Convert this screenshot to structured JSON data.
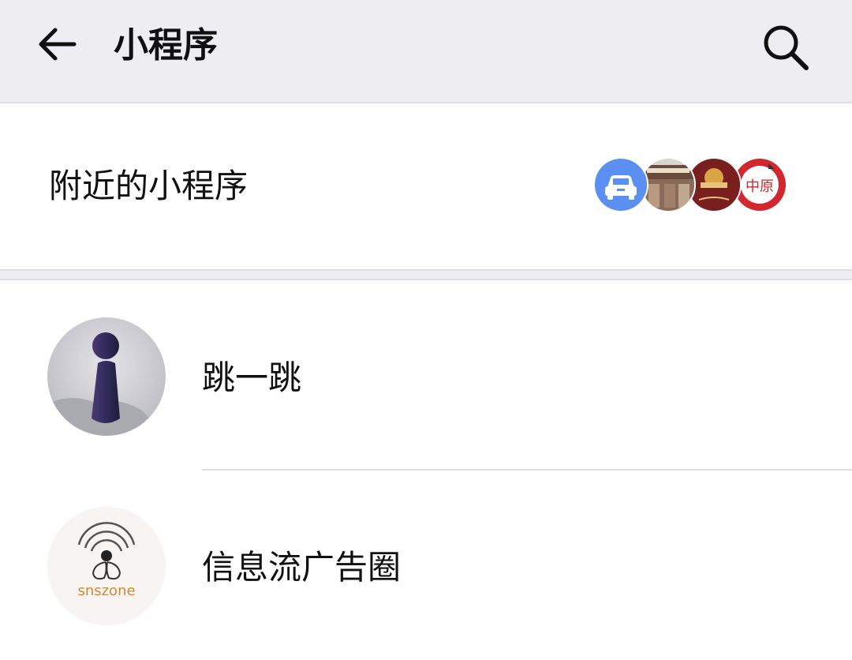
{
  "header": {
    "title": "小程序",
    "back_icon": "back-arrow-icon",
    "search_icon": "search-icon"
  },
  "nearby": {
    "label": "附近的小程序",
    "avatars": [
      {
        "icon": "car-icon",
        "color": "#5b8ff2"
      },
      {
        "icon": "storefront-photo",
        "color": "#7a4a3a"
      },
      {
        "icon": "restaurant-logo",
        "color": "#7a1f1f"
      },
      {
        "icon": "zhongyuan-logo",
        "color": "#d3272f",
        "text": "中原"
      }
    ]
  },
  "list": {
    "items": [
      {
        "label": "跳一跳",
        "icon": "jump-game-icon"
      },
      {
        "label": "信息流广告圈",
        "icon": "snszone-logo",
        "logo_text": "snszone"
      }
    ]
  },
  "colors": {
    "header_bg": "#ededf2",
    "accent_blue": "#5b8ff2",
    "text": "#111111"
  }
}
